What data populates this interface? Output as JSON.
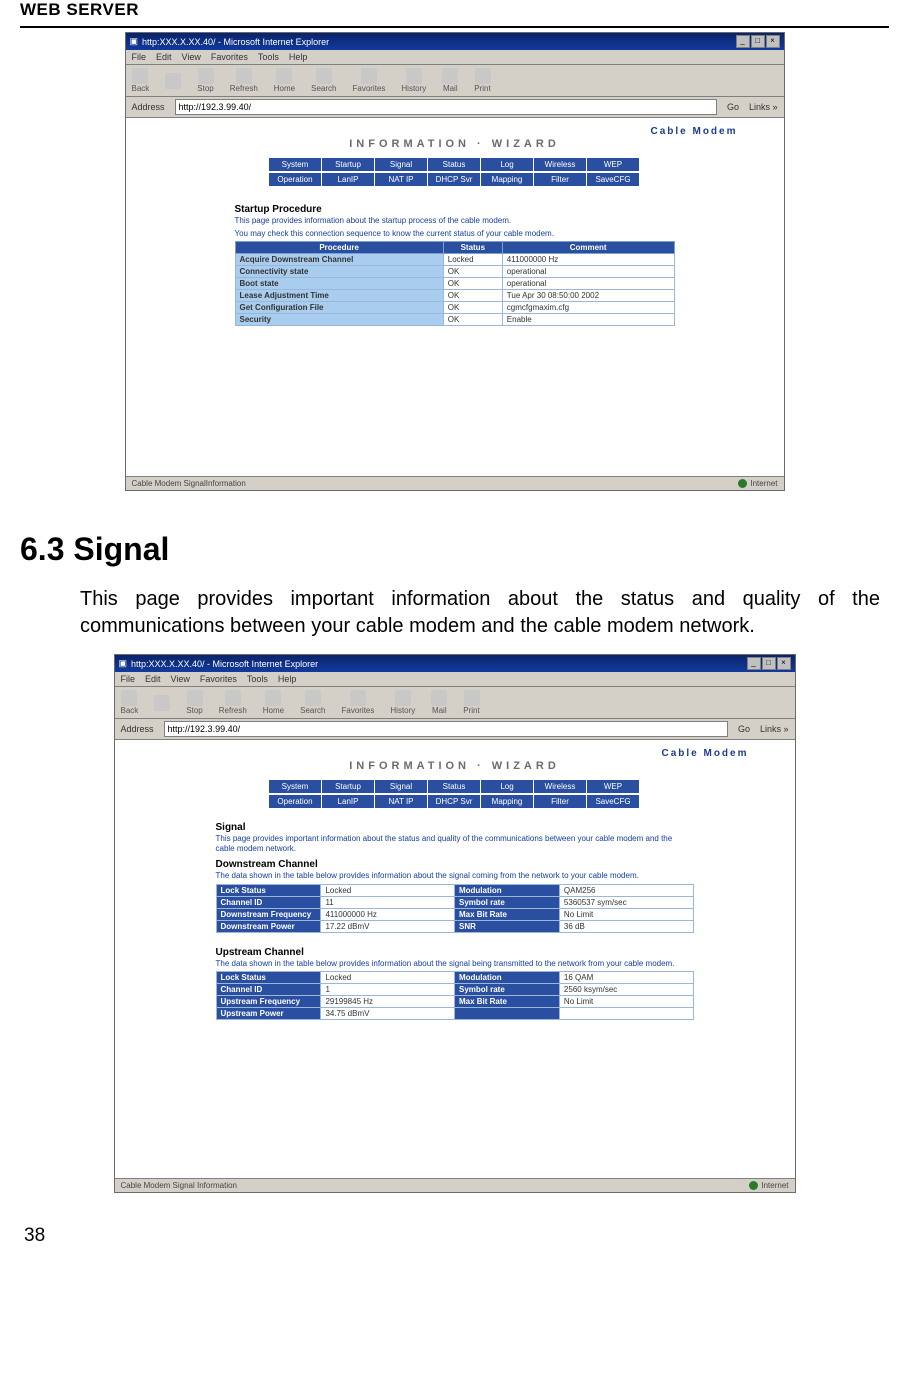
{
  "doc": {
    "header": "WEB SERVER",
    "section_num": "6.3 Signal",
    "body": "This page provides important information about the status and quality of the communications between your cable modem and the cable modem network.",
    "page": "38"
  },
  "common": {
    "banner_top": "Cable Modem",
    "banner_sub": "INFORMATION · WIZARD",
    "nav1": [
      "System",
      "Startup",
      "Signal",
      "Status",
      "Log",
      "Wireless",
      "WEP"
    ],
    "nav2": [
      "Operation",
      "LanIP",
      "NAT IP",
      "DHCP Svr",
      "Mapping",
      "Filter",
      "SaveCFG"
    ],
    "menubar": [
      "File",
      "Edit",
      "View",
      "Favorites",
      "Tools",
      "Help"
    ],
    "toolbar": [
      "Back",
      "",
      "Stop",
      "Refresh",
      "Home",
      "Search",
      "Favorites",
      "History",
      "Mail",
      "Print"
    ]
  },
  "shot1": {
    "title": "http:XXX.X.XX.40/ - Microsoft Internet Explorer",
    "address_label": "Address",
    "address": "http://192.3.99.40/",
    "go": "Go",
    "links": "Links »",
    "section": "Startup Procedure",
    "desc1": "This page provides information about the startup process of the cable modem.",
    "desc2": "You may check this connection sequence to know the current status of your cable modem.",
    "cols": [
      "Procedure",
      "Status",
      "Comment"
    ],
    "rows": [
      [
        "Acquire Downstream Channel",
        "Locked",
        "411000000 Hz"
      ],
      [
        "Connectivity state",
        "OK",
        "operational"
      ],
      [
        "Boot state",
        "OK",
        "operational"
      ],
      [
        "Lease Adjustment Time",
        "OK",
        "Tue Apr 30 08:50:00 2002"
      ],
      [
        "Get Configuration File",
        "OK",
        "cgmcfgmaxim.cfg"
      ],
      [
        "Security",
        "OK",
        "Enable"
      ]
    ],
    "status_left": "Cable Modem SignalInformation",
    "status_right": "Internet"
  },
  "shot2": {
    "title": "http:XXX.X.XX.40/ - Microsoft Internet Explorer",
    "address_label": "Address",
    "address": "http://192.3.99.40/",
    "go": "Go",
    "links": "Links »",
    "sig_title": "Signal",
    "sig_desc": "This page provides important information about the status and quality of the communications between your cable modem and the cable modem network.",
    "down_title": "Downstream Channel",
    "down_desc": "The data shown in the table below provides information about the signal coming from the network to your cable modem.",
    "down_rows": [
      [
        "Lock Status",
        "Locked",
        "Modulation",
        "QAM256"
      ],
      [
        "Channel ID",
        "11",
        "Symbol rate",
        "5360537 sym/sec"
      ],
      [
        "Downstream Frequency",
        "411000000 Hz",
        "Max Bit Rate",
        "No Limit"
      ],
      [
        "Downstream Power",
        "17.22 dBmV",
        "SNR",
        "36 dB"
      ]
    ],
    "up_title": "Upstream Channel",
    "up_desc": "The data shown in the table below provides information about the signal being transmitted to the network from your cable modem.",
    "up_rows": [
      [
        "Lock Status",
        "Locked",
        "Modulation",
        "16 QAM"
      ],
      [
        "Channel ID",
        "1",
        "Symbol rate",
        "2560 ksym/sec"
      ],
      [
        "Upstream Frequency",
        "29199845 Hz",
        "Max Bit Rate",
        "No Limit"
      ],
      [
        "Upstream Power",
        "34.75 dBmV",
        "",
        ""
      ]
    ],
    "status_left": "Cable Modem Signal Information",
    "status_right": "Internet"
  }
}
